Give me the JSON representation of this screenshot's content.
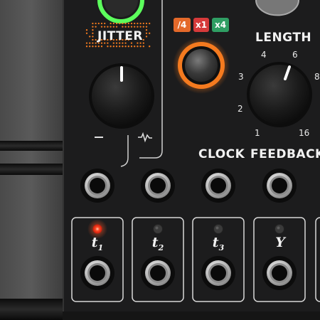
{
  "module": {
    "jitter_label": "JITTER",
    "length_label": "LENGTH",
    "clock_label": "CLOCK",
    "feedback_label": "FEEDBACK",
    "jitter_min_symbol": "—",
    "jitter_max_symbol": "squiggle",
    "colors": {
      "panel": "#1c1c1d",
      "accent_orange": "#f47a1f",
      "led_red": "#ff3b1e",
      "led_green": "#5cff5c",
      "badge_div": "#e4692a",
      "badge_mul": "#d63a3a",
      "badge_mul4": "#2f9e63"
    }
  },
  "rate_badges": [
    {
      "label": "/4",
      "color": "#e4692a"
    },
    {
      "label": "x1",
      "color": "#d63a3a"
    },
    {
      "label": "x4",
      "color": "#2f9e63"
    }
  ],
  "length_scale": [
    "1",
    "2",
    "3",
    "4",
    "6",
    "8",
    "16"
  ],
  "length_value": 6,
  "outputs": [
    {
      "label": "t",
      "sub": "1",
      "led": "on"
    },
    {
      "label": "t",
      "sub": "2",
      "led": "off"
    },
    {
      "label": "t",
      "sub": "3",
      "led": "off"
    },
    {
      "label": "Y",
      "sub": "",
      "led": "off"
    }
  ]
}
